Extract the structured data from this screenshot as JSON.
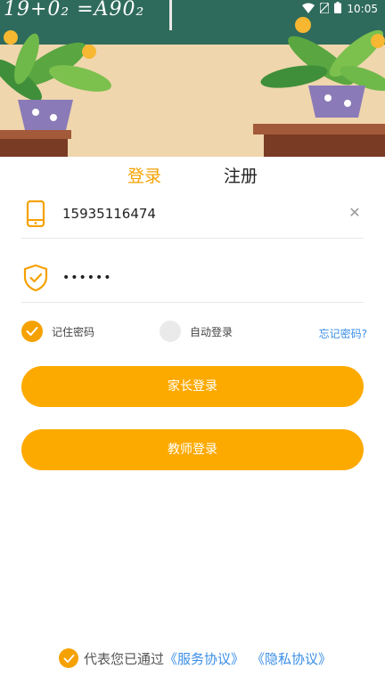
{
  "status_bar": {
    "time": "10:05",
    "icons": [
      "wifi-icon",
      "no-sim-icon",
      "battery-icon"
    ]
  },
  "banner": {
    "chalk_text": "19+0₂ =A90₂"
  },
  "tabs": {
    "login": "登录",
    "register": "注册"
  },
  "form": {
    "phone_value": "15935116474",
    "password_value": "••••••",
    "clear_symbol": "✕"
  },
  "options": {
    "remember_password": "记住密码",
    "auto_login": "自动登录",
    "forgot_password": "忘记密码?"
  },
  "buttons": {
    "parent_login": "家长登录",
    "teacher_login": "教师登录"
  },
  "agreement": {
    "prefix": "代表您已通过",
    "service": "《服务协议》",
    "privacy": "《隐私协议》"
  },
  "colors": {
    "accent": "#f5a100",
    "button": "#fdaa00",
    "link": "#3a8ee6"
  }
}
